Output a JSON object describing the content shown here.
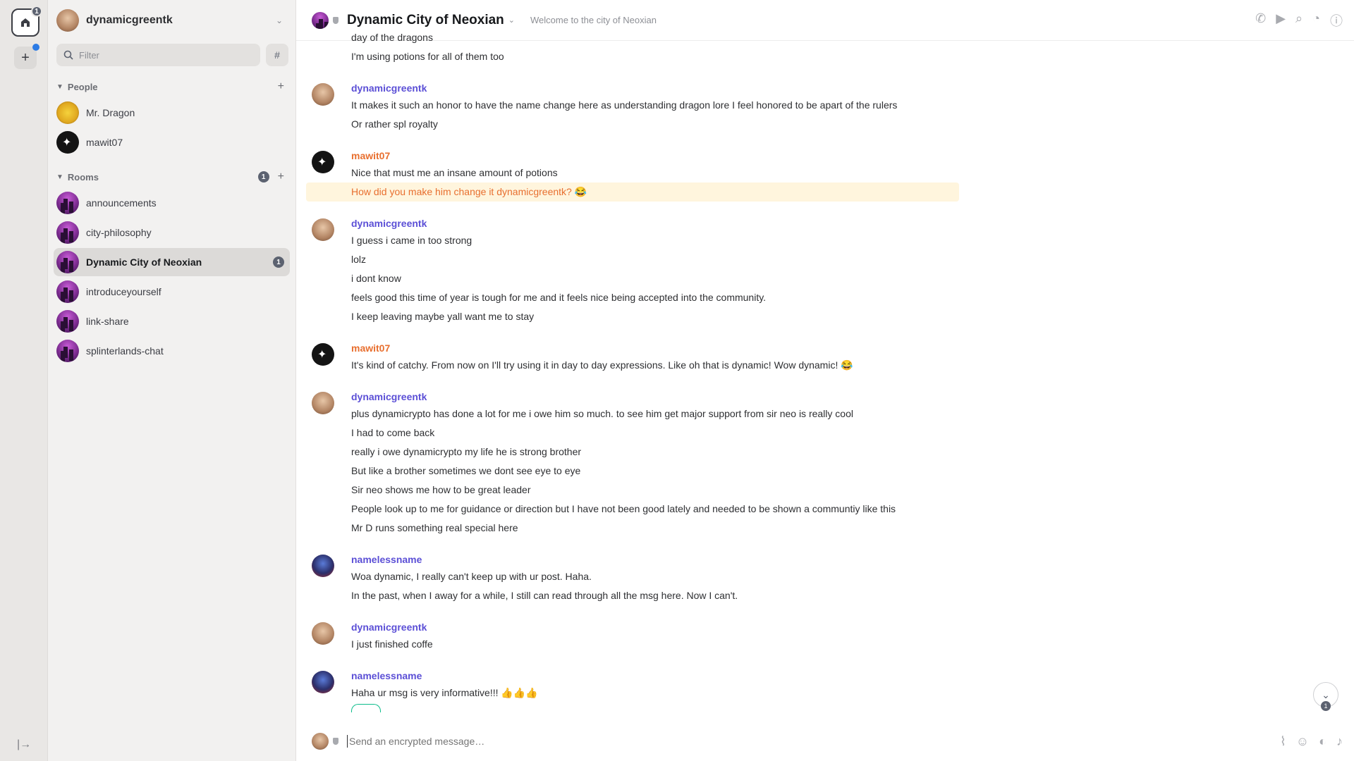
{
  "rail": {
    "home_badge": "1",
    "add_label": "+",
    "expand_label": "|→"
  },
  "panel": {
    "user_name": "dynamicgreentk",
    "filter_placeholder": "Filter",
    "people_title": "People",
    "people": [
      {
        "name": "Mr. Dragon"
      },
      {
        "name": "mawit07"
      }
    ],
    "rooms_title": "Rooms",
    "rooms_count": "1",
    "rooms": [
      {
        "name": "announcements"
      },
      {
        "name": "city-philosophy"
      },
      {
        "name": "Dynamic City of Neoxian",
        "badge": "1"
      },
      {
        "name": "introduceyourself"
      },
      {
        "name": "link-share"
      },
      {
        "name": "splinterlands-chat"
      }
    ]
  },
  "header": {
    "room_name": "Dynamic City of Neoxian",
    "topic": "Welcome to the city of Neoxian"
  },
  "timeline": {
    "g0": {
      "lines": [
        "day of the dragons",
        "I'm using potions for all of them too"
      ]
    },
    "g1": {
      "sender": "dynamicgreentk",
      "lines": [
        "It makes it such an honor to have the name change here as understanding dragon lore I feel honored to be apart of the rulers",
        "Or rather spl royalty"
      ]
    },
    "g2": {
      "sender": "mawit07",
      "lines": [
        "Nice that must me an insane amount of potions",
        "How did you make him change it dynamicgreentk? 😂"
      ]
    },
    "g3": {
      "sender": "dynamicgreentk",
      "lines": [
        "I guess i came in too strong",
        "lolz",
        "i dont know",
        "feels good this time of year is tough for me and it feels nice being accepted into the community.",
        "I keep leaving maybe yall want me to stay"
      ]
    },
    "g4": {
      "sender": "mawit07",
      "lines": [
        "It's kind of catchy. From now on I'll try using it in day to day expressions. Like oh that is dynamic! Wow dynamic! 😂"
      ]
    },
    "g5": {
      "sender": "dynamicgreentk",
      "lines": [
        "plus dynamicrypto has done a lot for me i owe him so much. to see him get major support from sir neo is really cool",
        "I had to come back",
        "really i owe dynamicrypto my life he is strong brother",
        "But like a brother sometimes we dont see eye to eye",
        "Sir neo shows me how to be great leader",
        "People look up to me for guidance or direction but I have not been good lately and needed to be shown a communtiy like this",
        "Mr D runs something real special here"
      ]
    },
    "g6": {
      "sender": "namelessname",
      "lines": [
        "Woa dynamic, I really can't keep up with ur post. Haha.",
        "In the past, when I away for a while, I still can read through all the msg here. Now I can't."
      ]
    },
    "g7": {
      "sender": "dynamicgreentk",
      "lines": [
        "I just finished coffe"
      ]
    },
    "g8": {
      "sender": "namelessname",
      "lines": [
        "Haha ur msg is very informative!!! 👍👍👍"
      ]
    },
    "jump_badge": "1"
  },
  "composer": {
    "placeholder": "Send an encrypted message…"
  },
  "icons": {
    "call": "phone-icon",
    "video": "video-icon",
    "search": "search-icon",
    "notifications": "bell-icon",
    "info": "info-icon",
    "attach": "paperclip-icon",
    "emoji": "emoji-icon",
    "sticker": "sticker-icon",
    "voice": "microphone-icon"
  },
  "colors": {
    "sender_purple": "#5b4fd6",
    "sender_orange": "#e86f2f",
    "highlight_bg": "#fff5dd",
    "badge": "#5c6270"
  }
}
